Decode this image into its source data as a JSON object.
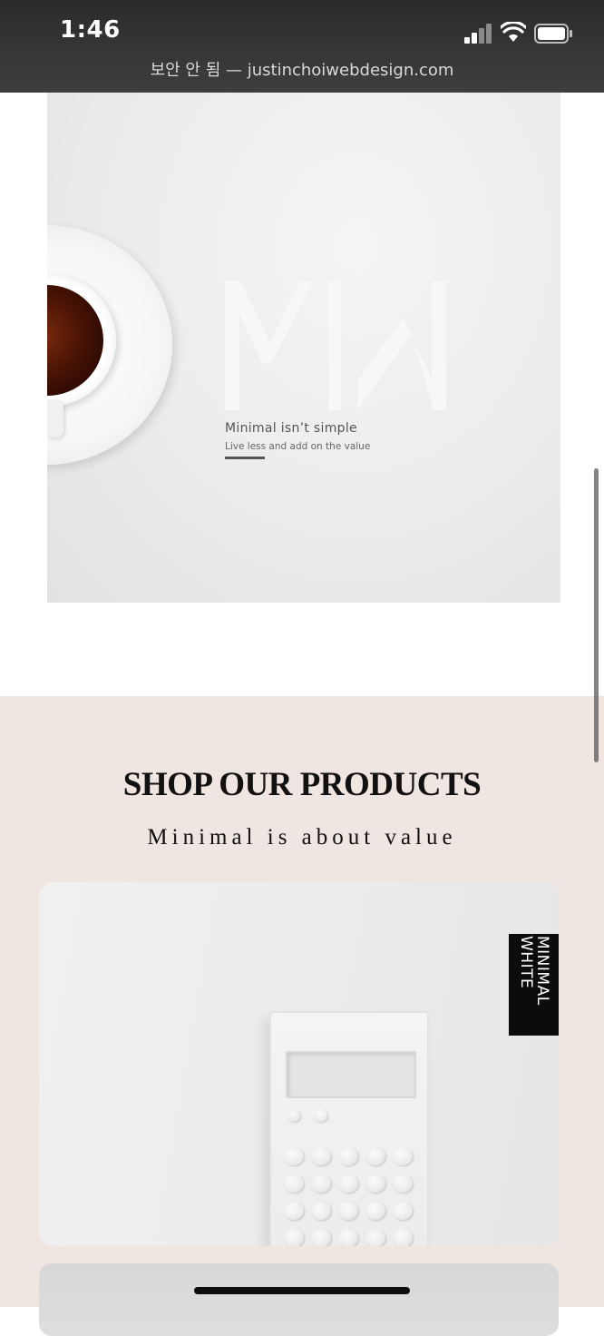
{
  "status_bar": {
    "time": "1:46",
    "url": "보안 안 됨 — justinchoiwebdesign.com",
    "signal_icon": "cellular-signal-icon",
    "wifi_icon": "wifi-icon",
    "battery_icon": "battery-icon"
  },
  "hero": {
    "logo_text": "MW",
    "title": "Minimal isn’t simple",
    "subtitle": "Live less and add on the value"
  },
  "products": {
    "heading": "SHOP OUR PRODUCTS",
    "subheading": "Minimal is about value",
    "card1": {
      "brand_line1": "MINIMAL",
      "brand_line2": "WHITE"
    }
  },
  "colors": {
    "section_background": "#efe6e1",
    "status_bar": "#333333"
  }
}
